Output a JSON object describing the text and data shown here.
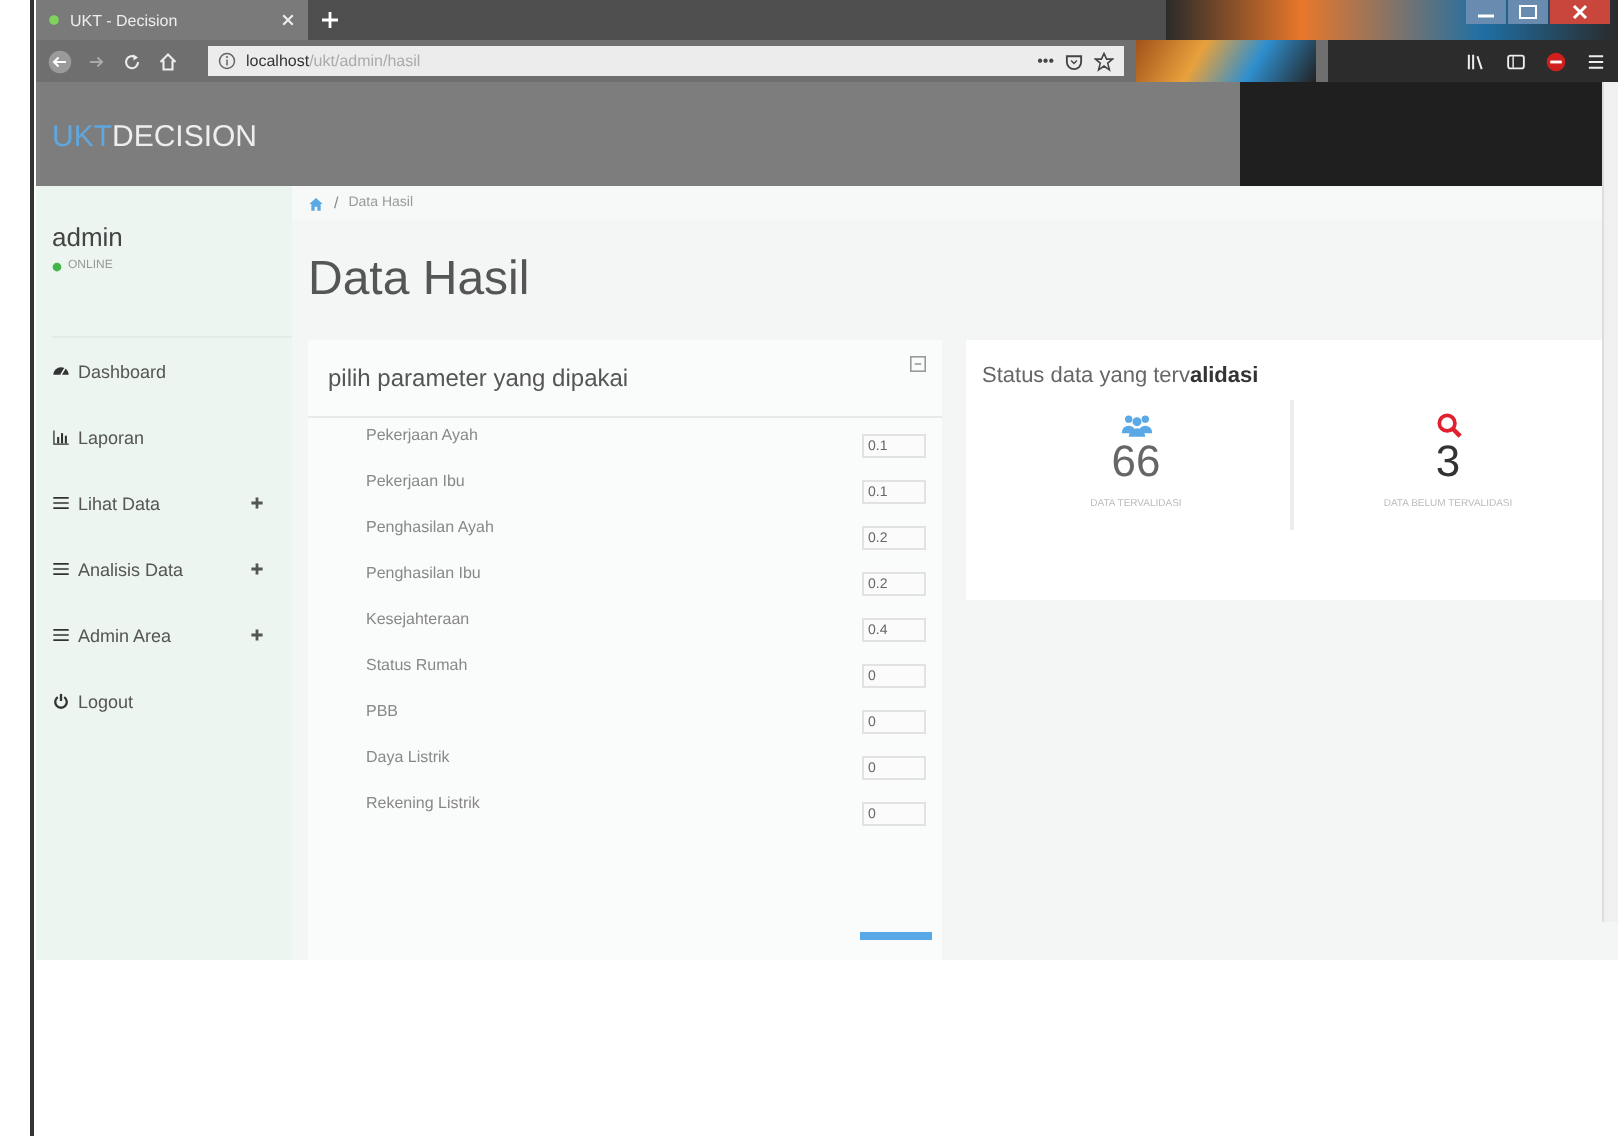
{
  "browser": {
    "tab": {
      "title": "UKT - Decision",
      "selected": true
    },
    "url_host": "localhost",
    "url_path": "/ukt/admin/hasil",
    "page_actions": "•••"
  },
  "app": {
    "logo_accent": "UKT",
    "logo_rest": "DECISION"
  },
  "sidebar": {
    "user": "admin",
    "status": "ONLINE",
    "items": [
      {
        "label": "Dashboard",
        "expandable": false
      },
      {
        "label": "Laporan",
        "expandable": false
      },
      {
        "label": "Lihat Data",
        "expandable": true
      },
      {
        "label": "Analisis Data",
        "expandable": true
      },
      {
        "label": "Admin Area",
        "expandable": true
      },
      {
        "label": "Logout",
        "expandable": false
      }
    ]
  },
  "breadcrumb": {
    "separator": "/",
    "items": [
      "Data Hasil"
    ]
  },
  "page_title": "Data Hasil",
  "parameters": {
    "title": "pilih parameter yang dipakai",
    "rows": [
      {
        "label": "Pekerjaan Ayah",
        "value": "0.1"
      },
      {
        "label": "Pekerjaan Ibu",
        "value": "0.1"
      },
      {
        "label": "Penghasilan Ayah",
        "value": "0.2"
      },
      {
        "label": "Penghasilan Ibu",
        "value": "0.2"
      },
      {
        "label": "Kesejahteraan",
        "value": "0.4"
      },
      {
        "label": "Status Rumah",
        "value": "0"
      },
      {
        "label": "PBB",
        "value": "0"
      },
      {
        "label": "Daya Listrik",
        "value": "0"
      },
      {
        "label": "Rekening Listrik",
        "value": "0"
      }
    ]
  },
  "status": {
    "title": "Status data yang terv**alidasi**",
    "stats": [
      {
        "kind": "users",
        "value": "66",
        "label": "DATA TERVALIDASI",
        "color": "#5aa9e6"
      },
      {
        "kind": "search",
        "value": "3",
        "label": "DATA BELUM TERVALIDASI",
        "color": "#e0202e"
      }
    ]
  }
}
